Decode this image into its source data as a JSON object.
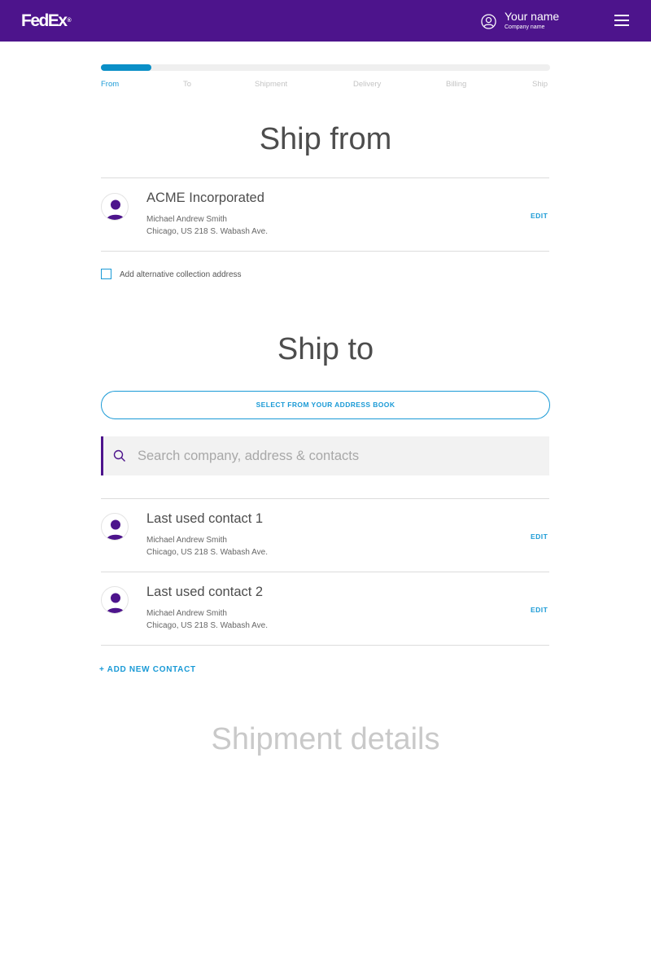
{
  "header": {
    "logo": {
      "fed": "Fed",
      "ex": "Ex",
      "mark": "®"
    },
    "user_name": "Your name",
    "company_name": "Company name",
    "icons": {
      "user": "user-circle-icon",
      "menu": "hamburger-menu-icon"
    },
    "background_color": "#4d148c"
  },
  "progress": {
    "fraction": 0.112,
    "fill_color": "#0a8fc7",
    "steps": [
      {
        "label": "From",
        "active": true
      },
      {
        "label": "To",
        "active": false
      },
      {
        "label": "Shipment",
        "active": false
      },
      {
        "label": "Delivery",
        "active": false
      },
      {
        "label": "Billing",
        "active": false
      },
      {
        "label": "Ship",
        "active": false
      }
    ]
  },
  "ship_from": {
    "title": "Ship from",
    "contact": {
      "name": "ACME Incorporated",
      "person": "Michael Andrew Smith",
      "address": "Chicago, US 218 S. Wabash Ave.",
      "edit_label": "EDIT"
    },
    "alt_address_label": "Add alternative collection address",
    "alt_address_checked": false
  },
  "ship_to": {
    "title": "Ship to",
    "address_book_label": "SELECT FROM YOUR ADDRESS BOOK",
    "search_placeholder": "Search company, address & contacts",
    "contacts": [
      {
        "name": "Last used contact 1",
        "person": "Michael Andrew Smith",
        "address": "Chicago, US 218 S. Wabash Ave.",
        "edit_label": "EDIT"
      },
      {
        "name": "Last used contact 2",
        "person": "Michael Andrew Smith",
        "address": "Chicago, US 218 S. Wabash Ave.",
        "edit_label": "EDIT"
      }
    ],
    "add_contact_label": "+ ADD NEW CONTACT"
  },
  "shipment_details": {
    "title": "Shipment details"
  },
  "colors": {
    "accent": "#1a9ad6",
    "brand_purple": "#4d148c",
    "avatar_purple": "#4d148c"
  }
}
